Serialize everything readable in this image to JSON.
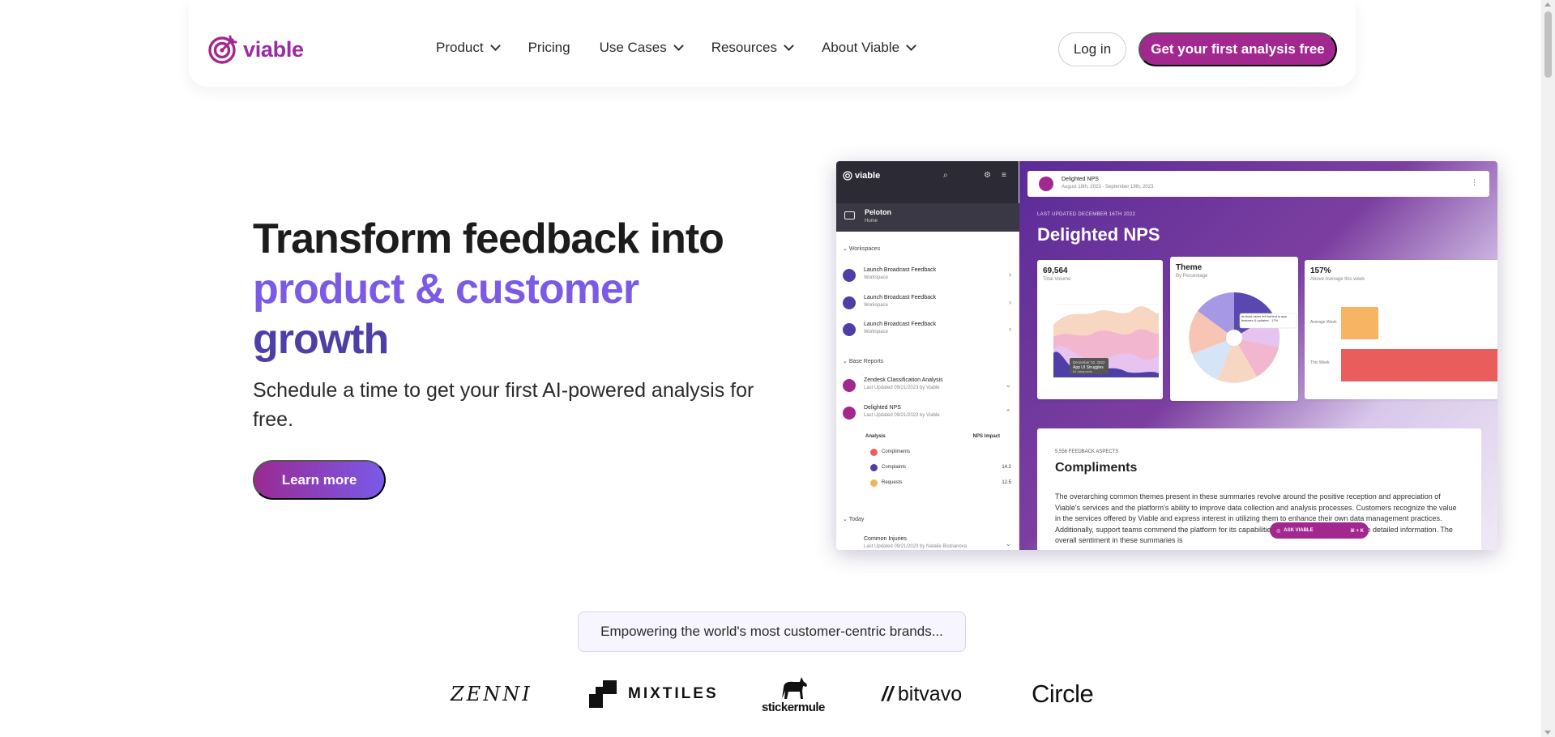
{
  "nav": {
    "logo_text": "viable",
    "menu": [
      {
        "label": "Product",
        "has_dropdown": true
      },
      {
        "label": "Pricing",
        "has_dropdown": false
      },
      {
        "label": "Use Cases",
        "has_dropdown": true
      },
      {
        "label": "Resources",
        "has_dropdown": true
      },
      {
        "label": "About Viable",
        "has_dropdown": true
      }
    ],
    "login_label": "Log in",
    "cta_label": "Get your first analysis free"
  },
  "hero": {
    "title_line1": "Transform feedback into",
    "title_line2": "product & customer",
    "title_line3": "growth",
    "subtitle": "Schedule a time to get your first AI-powered analysis for free.",
    "learn_more_label": "Learn more"
  },
  "app_preview": {
    "sidebar": {
      "logo": "viable",
      "org_name": "Peloton",
      "org_sub": "Home",
      "workspaces_label": "Workspaces",
      "workspaces": [
        {
          "title": "Launch Broadcast Feedback",
          "sub": "Workspace"
        },
        {
          "title": "Launch Broadcast Feedback",
          "sub": "Workspace"
        },
        {
          "title": "Launch Broadcast Feedback",
          "sub": "Workspace"
        }
      ],
      "base_reports_label": "Base Reports",
      "reports": [
        {
          "title": "Zendesk Classification Analysis",
          "sub": "Last Updated 09/21/2023 by Viable"
        },
        {
          "title": "Delighted NPS",
          "sub": "Last Updated 09/21/2023 by Viable"
        }
      ],
      "analysis_label": "Analysis",
      "nps_impact_label": "NPS Impact",
      "analysis_rows": [
        {
          "label": "Compliments",
          "value": "",
          "color": "#e95d5d"
        },
        {
          "label": "Complaints",
          "value": "14.2",
          "color": "#4e3fa7"
        },
        {
          "label": "Requests",
          "value": "12.5",
          "color": "#f0b25c"
        }
      ],
      "today_label": "Today",
      "today_item": {
        "title": "Common Injuries",
        "sub": "Last Updated 09/21/2023 by Natalie Bistrianova"
      }
    },
    "header": {
      "title": "Delighted NPS",
      "date_range": "August 18th, 2023 - September 19th, 2023"
    },
    "last_updated": "LAST UPDATED DECEMBER 16TH 2022",
    "page_title": "Delighted NPS",
    "cards": {
      "volume": {
        "value": "69,564",
        "label": "Total Volume",
        "tooltip_date": "December 02, 2022",
        "tooltip_title": "App UI Struggles",
        "tooltip_sub": "84 datapoints"
      },
      "theme": {
        "title": "Theme",
        "label": "By Percentage",
        "tooltip": "android users left behind in app features & updates - 17%"
      },
      "above": {
        "value": "157%",
        "label": "Above Average this week",
        "row1": "Average Week",
        "row2": "This Week"
      }
    },
    "compliments": {
      "label": "5,556 FEEDBACK ASPECTS",
      "title": "Compliments",
      "body": "The overarching common themes present in these summaries revolve around the positive reception and appreciation of Viable's services and the platform's ability to improve data collection and analysis processes. Customers recognize the value in the services offered by Viable and express interest in utilizing them to enhance their own data management practices. Additionally, support teams commend the platform for its capabilities, which save time and provide detailed information. The overall sentiment in these summaries is"
    },
    "ask_label": "ASK VIABLE",
    "ask_shortcut": "⌘ + K"
  },
  "brands": {
    "tagline": "Empowering the world's most customer-centric brands...",
    "logos": [
      "ZENNI",
      "MIXTILES",
      "stickermule",
      "bitvavo",
      "Circle"
    ]
  },
  "colors": {
    "brand": "#a2288f",
    "accent_purple": "#7b5be5",
    "deep_purple": "#4e3fa7"
  }
}
